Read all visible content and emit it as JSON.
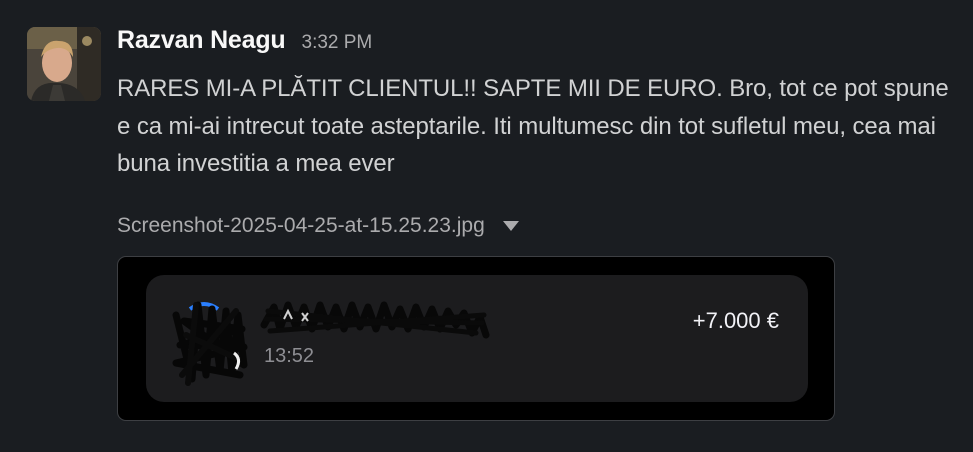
{
  "message": {
    "author": "Razvan Neagu",
    "timestamp": "3:32 PM",
    "text": "RARES MI-A PLĂTIT CLIENTUL!! SAPTE MII DE EURO. Bro, tot ce pot spune e ca mi-ai intrecut toate asteptarile. Iti multumesc din tot sufletul meu, cea mai buna investitia a mea ever",
    "attachment": {
      "file_name": "Screenshot-2025-04-25-at-15.25.23.jpg",
      "caret_icon": "caret-down-icon",
      "preview": {
        "time": "13:52",
        "amount": "+7.000 €"
      }
    }
  },
  "colors": {
    "background": "#1a1d21",
    "author": "#f8f8f8",
    "text": "#d1d2d3",
    "muted": "#ababad",
    "card": "#1c1c1e"
  }
}
